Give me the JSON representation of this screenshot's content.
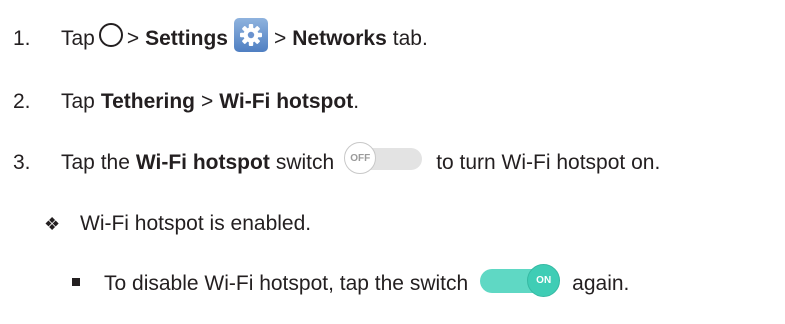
{
  "steps": [
    {
      "number": "1.",
      "parts": {
        "t1": "Tap",
        "t2": ">",
        "b1": "Settings",
        "t3": ">",
        "b2": "Networks",
        "t4": "tab."
      }
    },
    {
      "number": "2.",
      "parts": {
        "t1": "Tap",
        "b1": "Tethering",
        "t2": ">",
        "b2": "Wi-Fi hotspot",
        "t3": "."
      }
    },
    {
      "number": "3.",
      "parts": {
        "t1": "Tap the",
        "b1": "Wi-Fi hotspot",
        "t2": "switch",
        "t3": "to turn Wi-Fi hotspot on."
      }
    }
  ],
  "result": {
    "bullet": "❖",
    "text": "Wi-Fi hotspot is enabled."
  },
  "note": {
    "t1": "To disable Wi-Fi hotspot, tap the switch",
    "t2": "again."
  },
  "switches": {
    "off_label": "OFF",
    "on_label": "ON",
    "on_color": "#5fd8c4",
    "off_color": "#e3e3e3"
  },
  "icons": {
    "home": "home-circle-icon",
    "settings": "settings-gear-icon"
  }
}
